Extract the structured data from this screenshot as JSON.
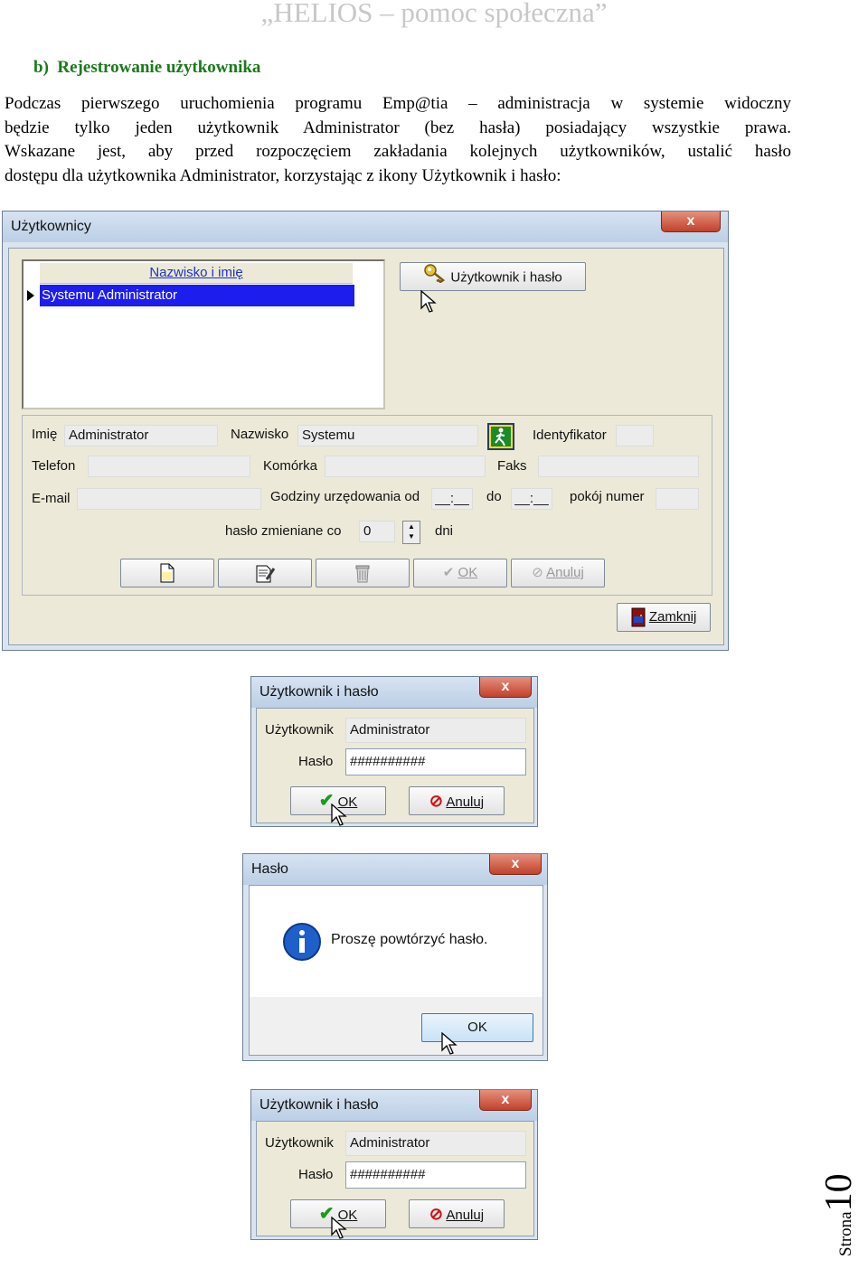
{
  "header": "„HELIOS – pomoc społeczna”",
  "section": {
    "marker": "b)",
    "title": "Rejestrowanie użytkownika"
  },
  "paragraph": {
    "line1": "Podczas pierwszego uruchomienia programu Emp@tia – administracja w systemie widoczny",
    "line2": "będzie tylko jeden użytkownik Administrator (bez hasła) posiadający wszystkie prawa.",
    "line3": "Wskazane jest, aby przed rozpoczęciem zakładania kolejnych użytkowników, ustalić hasło",
    "line4": "dostępu dla użytkownika Administrator, korzystając z ikony Użytkownik i hasło:"
  },
  "users_window": {
    "title": "Użytkownicy",
    "close": "x",
    "list_header": "Nazwisko i imię",
    "list_row": "Systemu Administrator",
    "user_pass_button": "Użytkownik i hasło",
    "labels": {
      "imie": "Imię",
      "nazwisko": "Nazwisko",
      "identyfikator": "Identyfikator",
      "telefon": "Telefon",
      "komorka": "Komórka",
      "faks": "Faks",
      "email": "E-mail",
      "godziny": "Godziny urzędowania od",
      "do": "do",
      "pokoj": "pokój numer",
      "haslo_co": "hasło zmieniane co",
      "dni": "dni"
    },
    "values": {
      "imie": "Administrator",
      "nazwisko": "Systemu",
      "godz_od": "__:__",
      "godz_do": "__:__",
      "haslo_co": "0"
    },
    "ok": "OK",
    "cancel": "Anuluj",
    "close_button": "Zamknij"
  },
  "dialog1": {
    "title": "Użytkownik i hasło",
    "close": "x",
    "user_label": "Użytkownik",
    "user_value": "Administrator",
    "pass_label": "Hasło",
    "pass_value": "##########",
    "ok": "OK",
    "cancel": "Anuluj"
  },
  "dialog2": {
    "title": "Hasło",
    "close": "x",
    "message": "Proszę powtórzyć hasło.",
    "ok": "OK"
  },
  "dialog3": {
    "title": "Użytkownik i hasło",
    "close": "x",
    "user_label": "Użytkownik",
    "user_value": "Administrator",
    "pass_label": "Hasło",
    "pass_value": "##########",
    "ok": "OK",
    "cancel": "Anuluj"
  },
  "footer": {
    "label": "Strona",
    "number": "10"
  }
}
